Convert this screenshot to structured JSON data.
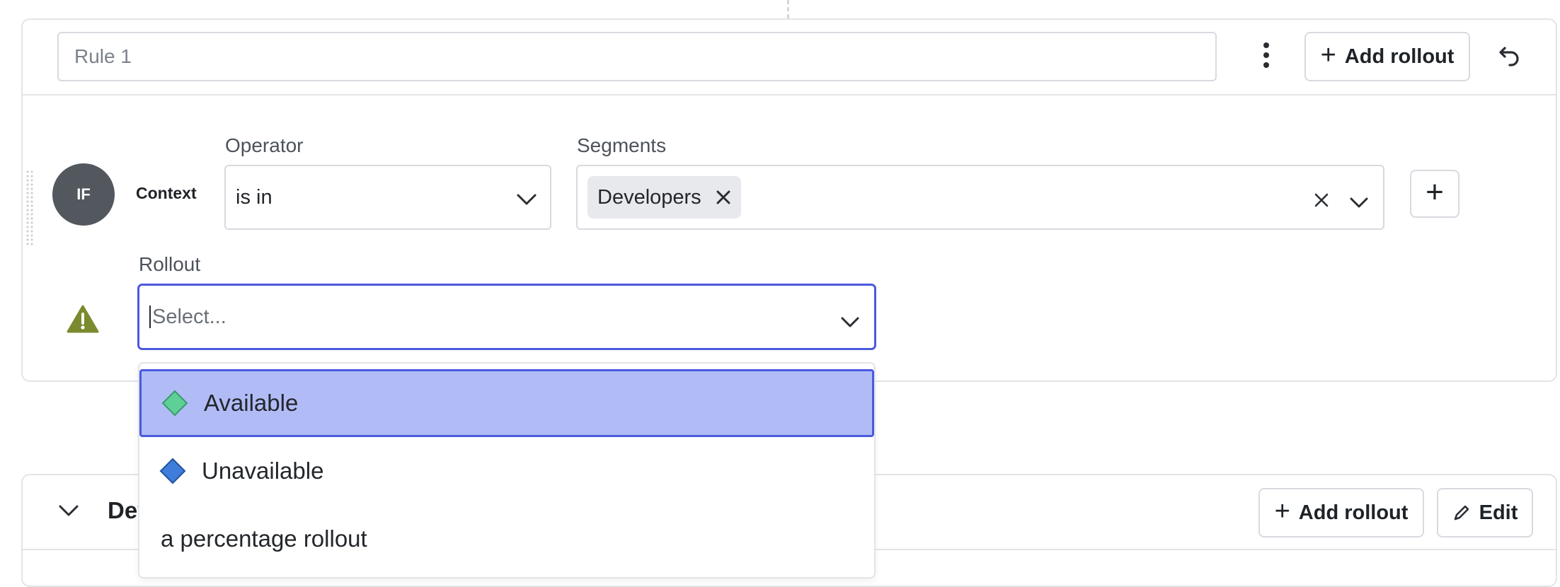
{
  "rule": {
    "name_placeholder": "Rule 1",
    "add_rollout_label": "Add rollout",
    "more_icon": "kebab-vertical-icon",
    "undo_icon": "undo-icon"
  },
  "condition": {
    "if_badge": "IF",
    "attribute_label": "Context",
    "operator_label": "Operator",
    "operator_value": "is in",
    "segments_label": "Segments",
    "segments": [
      "Developers"
    ]
  },
  "rollout": {
    "label": "Rollout",
    "placeholder": "Select...",
    "warning_icon": "warning-triangle-icon",
    "warning_color": "#7a8a2e",
    "options": [
      {
        "label": "Available",
        "icon": "diamond-icon",
        "color": "#5fcf98",
        "highlighted": true
      },
      {
        "label": "Unavailable",
        "icon": "diamond-icon",
        "color": "#3f7ddb",
        "highlighted": false
      },
      {
        "label": "a percentage rollout",
        "icon": "",
        "color": "",
        "highlighted": false
      }
    ]
  },
  "default_rule": {
    "title_visible": "Dev",
    "add_rollout_label": "Add rollout",
    "edit_label": "Edit"
  },
  "colors": {
    "focus_border": "#4b59dd",
    "highlight_bg": "#b1bcf7"
  }
}
